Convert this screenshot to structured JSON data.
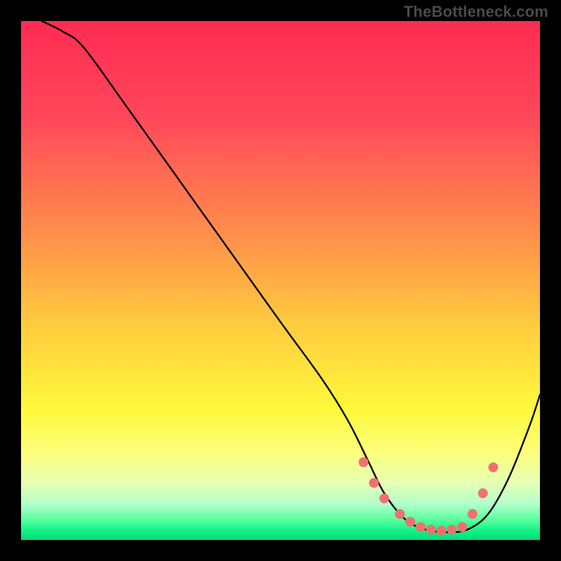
{
  "watermark": "TheBottleneck.com",
  "chart_data": {
    "type": "line",
    "title": "",
    "xlabel": "",
    "ylabel": "",
    "xlim": [
      0,
      100
    ],
    "ylim": [
      0,
      100
    ],
    "gradient_stops": [
      {
        "offset": 0,
        "color": "#ff2b52"
      },
      {
        "offset": 18,
        "color": "#ff465a"
      },
      {
        "offset": 40,
        "color": "#ff8b4c"
      },
      {
        "offset": 58,
        "color": "#ffca3e"
      },
      {
        "offset": 75,
        "color": "#fff93c"
      },
      {
        "offset": 83,
        "color": "#fdff7a"
      },
      {
        "offset": 89,
        "color": "#e6ffb3"
      },
      {
        "offset": 93,
        "color": "#b3ffcc"
      },
      {
        "offset": 96,
        "color": "#5cff9e"
      },
      {
        "offset": 98,
        "color": "#17f58a"
      },
      {
        "offset": 100,
        "color": "#00da7a"
      }
    ],
    "series": [
      {
        "name": "bottleneck-curve",
        "x": [
          4,
          8,
          12,
          20,
          30,
          40,
          50,
          58,
          63,
          67,
          70,
          74,
          78,
          82,
          86,
          90,
          94,
          98,
          100
        ],
        "y": [
          100,
          98,
          95,
          84,
          70,
          56,
          42,
          31,
          23,
          15,
          9,
          4,
          2,
          1.5,
          2,
          5,
          12,
          22,
          28
        ]
      }
    ],
    "markers": {
      "name": "highlight-dots",
      "color": "#f07070",
      "points": [
        {
          "x": 66,
          "y": 15
        },
        {
          "x": 68,
          "y": 11
        },
        {
          "x": 70,
          "y": 8
        },
        {
          "x": 73,
          "y": 5
        },
        {
          "x": 75,
          "y": 3.5
        },
        {
          "x": 77,
          "y": 2.5
        },
        {
          "x": 79,
          "y": 2
        },
        {
          "x": 81,
          "y": 1.8
        },
        {
          "x": 83,
          "y": 2
        },
        {
          "x": 85,
          "y": 2.5
        },
        {
          "x": 87,
          "y": 5
        },
        {
          "x": 89,
          "y": 9
        },
        {
          "x": 91,
          "y": 14
        }
      ]
    }
  }
}
